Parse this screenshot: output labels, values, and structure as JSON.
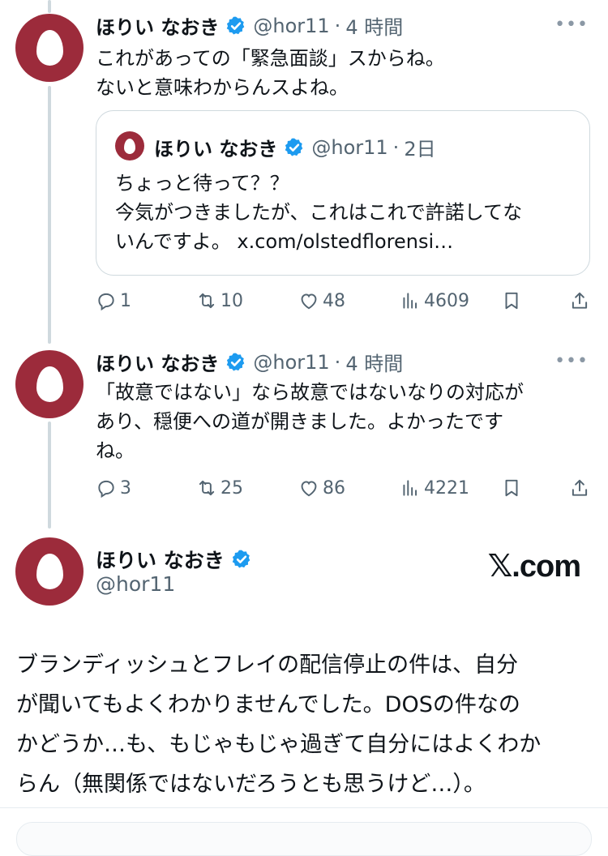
{
  "colors": {
    "avatar_bg": "#9c2b3b",
    "verified": "#1d9bf0",
    "secondary_text": "#536471",
    "thread_line": "#cfd9de"
  },
  "tweets": [
    {
      "name": "ほりい なおき",
      "handle": "@hor11",
      "sep": "·",
      "time": "4 時間",
      "more": "•••",
      "lines": [
        "これがあっての「緊急面談」スからね。",
        "ないと意味わからんスよね。"
      ],
      "quote": {
        "name": "ほりい なおき",
        "handle": "@hor11",
        "sep": "·",
        "time": "2日",
        "lines": [
          "ちょっと待って？？",
          "今気がつきましたが、これはこれで許諾してな",
          "いんですよ。 x.com/olstedflorensi…"
        ]
      },
      "actions": {
        "replies": "1",
        "reposts": "10",
        "likes": "48",
        "views": "4609"
      }
    },
    {
      "name": "ほりい なおき",
      "handle": "@hor11",
      "sep": "·",
      "time": "4 時間",
      "more": "•••",
      "lines": [
        "「故意ではない」なら故意ではないなりの対応が",
        "あり、穏便への道が開きました。よかったです",
        "ね。"
      ],
      "actions": {
        "replies": "3",
        "reposts": "25",
        "likes": "86",
        "views": "4221"
      }
    }
  ],
  "embed": {
    "name": "ほりい なおき",
    "handle": "@hor11",
    "brand": "𝕏.com",
    "lines": [
      "ブランディッシュとフレイの配信停止の件は、自分",
      "が聞いてもよくわかりませんでした。DOSの件なの",
      "かどうか…も、もじゃもじゃ過ぎて自分にはよくわか",
      "らん（無関係ではないだろうとも思うけど…）。"
    ]
  },
  "icons": [
    "reply-icon",
    "repost-icon",
    "like-icon",
    "views-icon",
    "bookmark-icon",
    "share-icon",
    "verified-badge-icon",
    "more-icon"
  ]
}
